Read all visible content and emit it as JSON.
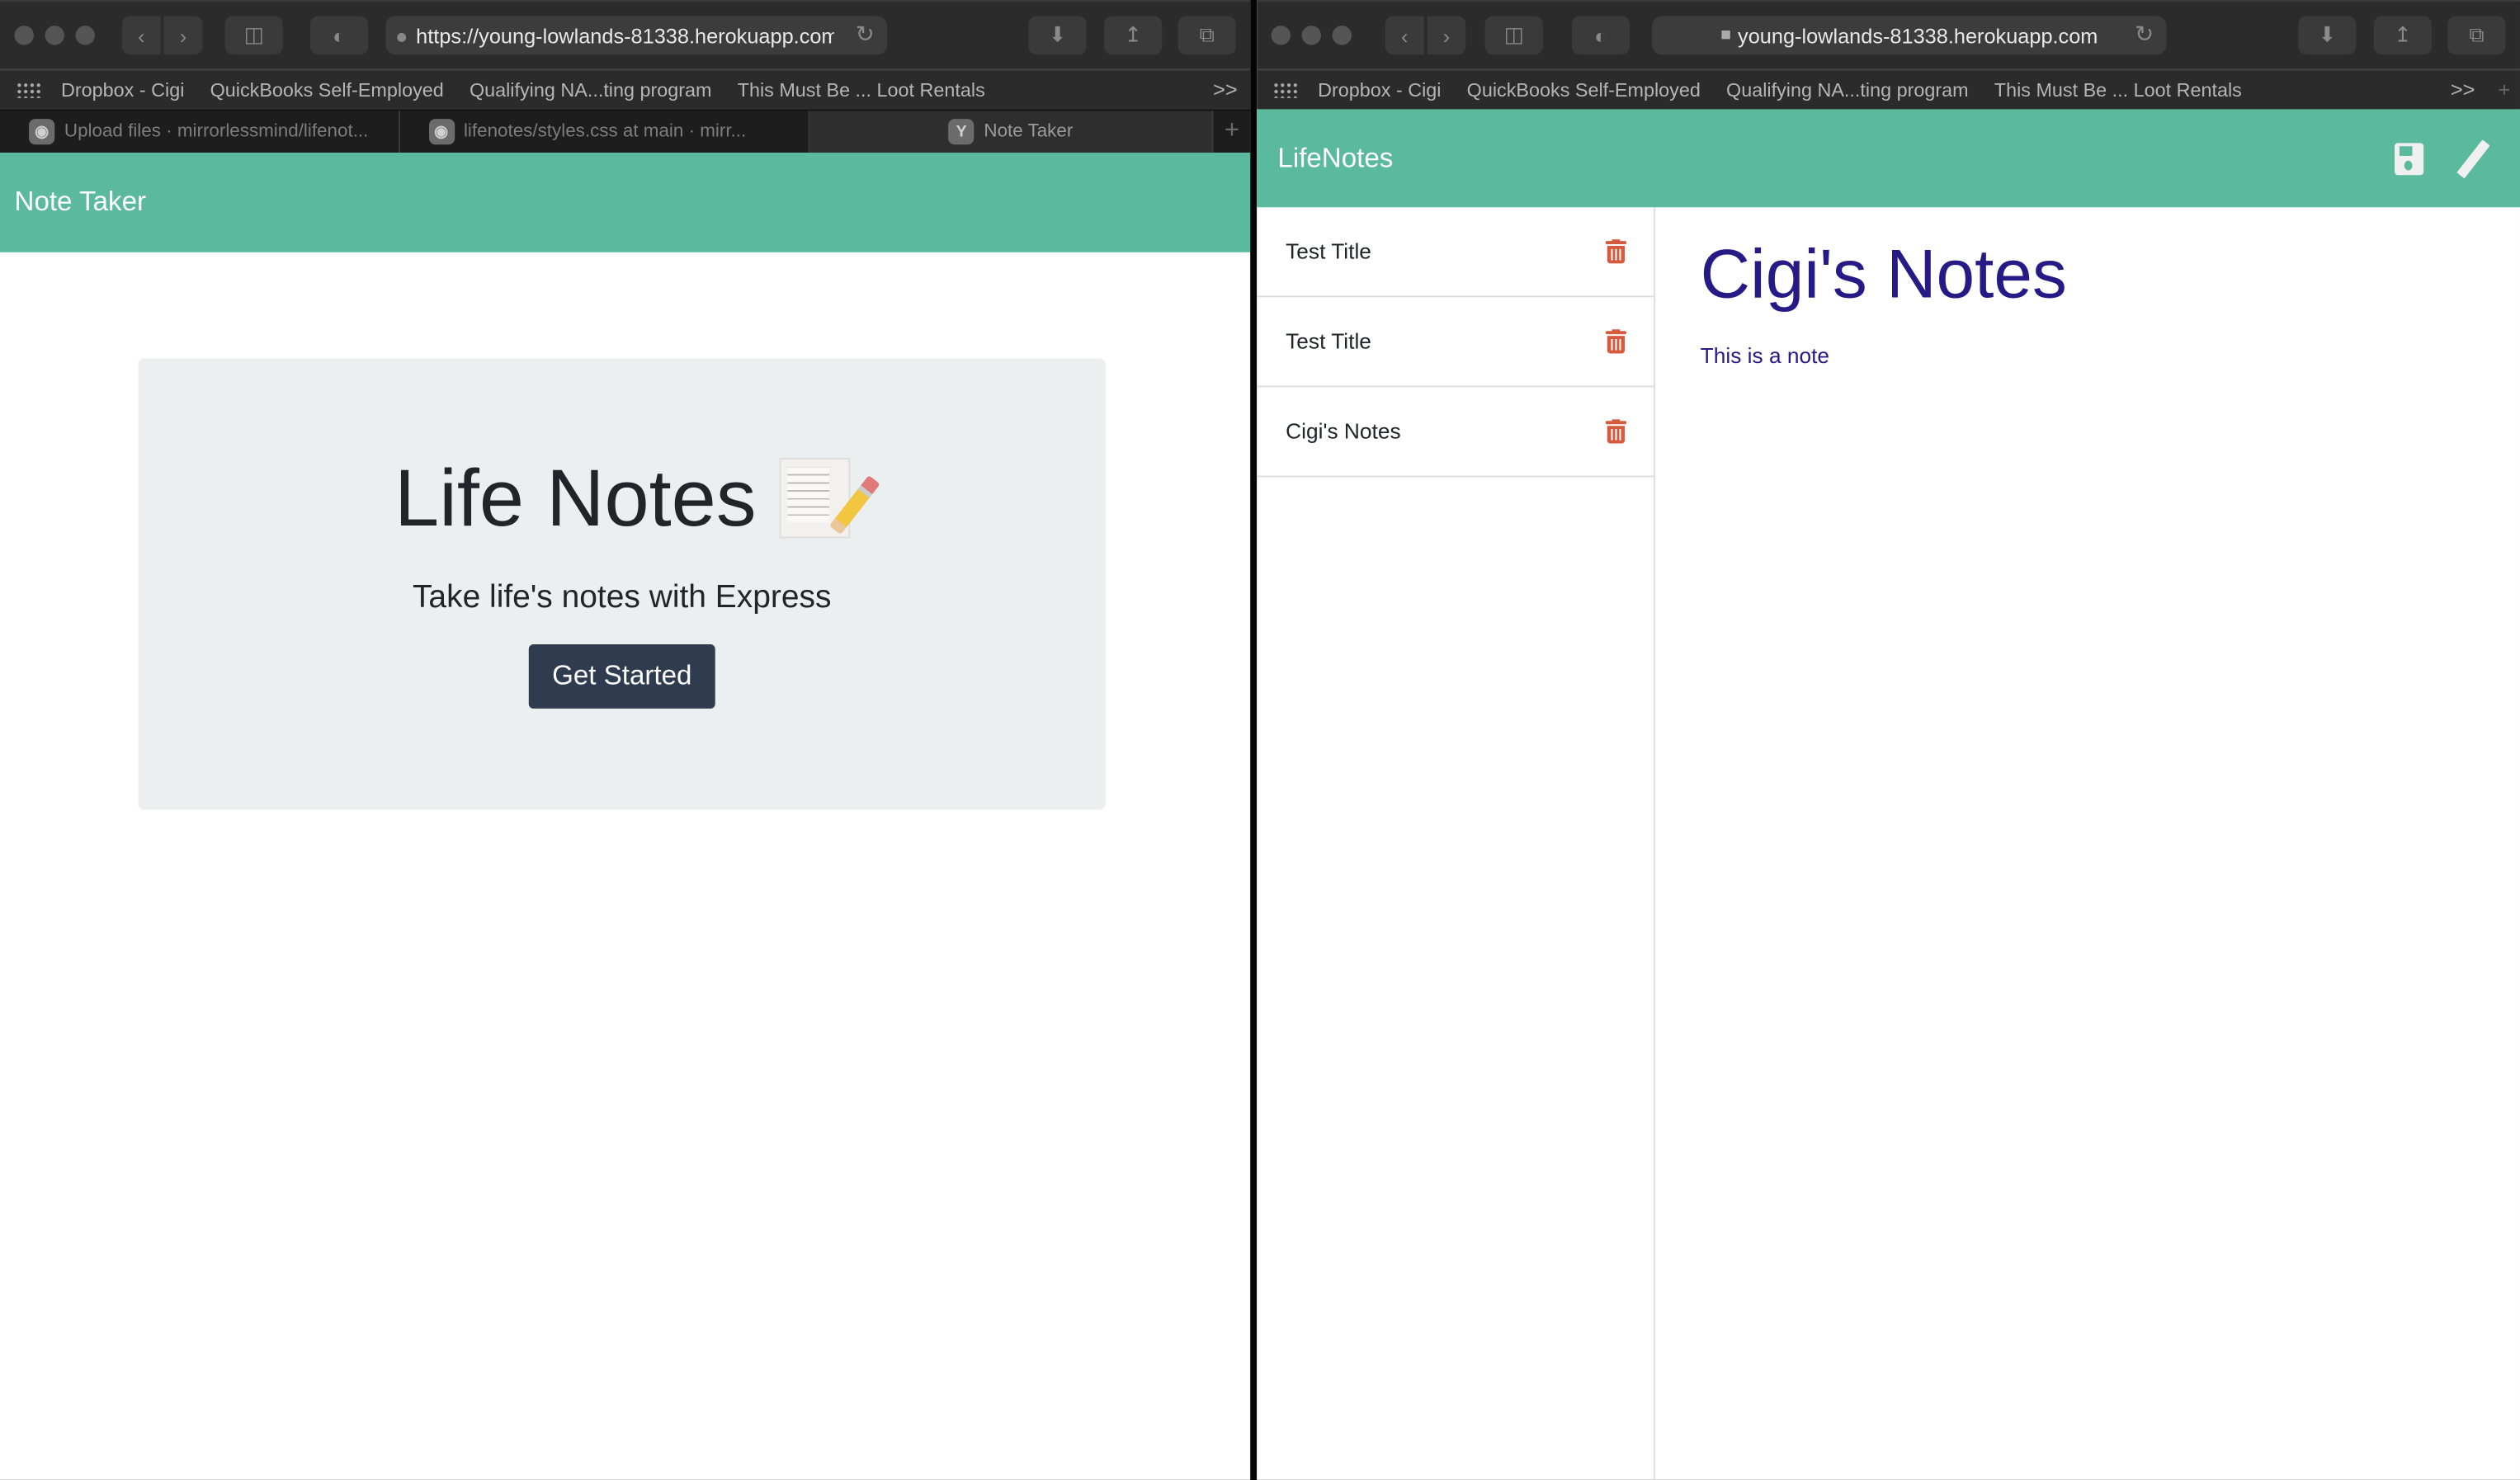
{
  "left_window": {
    "toolbar": {
      "url": "https://young-lowlands-81338.herokuapp.com",
      "icons": [
        "back-icon",
        "forward-icon",
        "sidebar-icon",
        "privacy-shield-icon",
        "globe-icon",
        "reload-icon",
        "download-icon",
        "share-icon",
        "tabs-overview-icon"
      ]
    },
    "bookmarks": [
      "Dropbox - Cigi",
      "QuickBooks Self-Employed",
      "Qualifying NA...ting program",
      "This Must Be ... Loot Rentals"
    ],
    "bookmarks_more": ">>",
    "tabs": [
      {
        "label": "Upload files · mirrorlessmind/lifenot...",
        "favicon": "github-icon",
        "active": false
      },
      {
        "label": "lifenotes/styles.css at main · mirr...",
        "favicon": "github-icon",
        "active": false
      },
      {
        "label": "Note Taker",
        "favicon": "Y",
        "active": true
      }
    ],
    "tab_add": "+",
    "navbar_title": "Note Taker",
    "hero": {
      "title": "Life Notes",
      "emoji": "memo-icon",
      "subtitle": "Take life's notes with Express",
      "button_label": "Get Started"
    }
  },
  "right_window": {
    "toolbar": {
      "url": "young-lowlands-81338.herokuapp.com",
      "secure": true
    },
    "bookmarks": [
      "Dropbox - Cigi",
      "QuickBooks Self-Employed",
      "Qualifying NA...ting program",
      "This Must Be ... Loot Rentals"
    ],
    "bookmarks_more": ">>",
    "tab_add": "+",
    "navbar_title": "LifeNotes",
    "navbar_icons": [
      "save-icon",
      "pencil-icon"
    ],
    "notes": [
      {
        "title": "Test Title"
      },
      {
        "title": "Test Title"
      },
      {
        "title": "Cigi's Notes"
      }
    ],
    "active_note": {
      "title": "Cigi's Notes",
      "text": "This is a note"
    }
  },
  "colors": {
    "navbar": "#5bb99d",
    "hero_bg": "#eceff0",
    "button": "#2f3c50",
    "trash": "#d55b3e",
    "note_text": "#261a87"
  }
}
